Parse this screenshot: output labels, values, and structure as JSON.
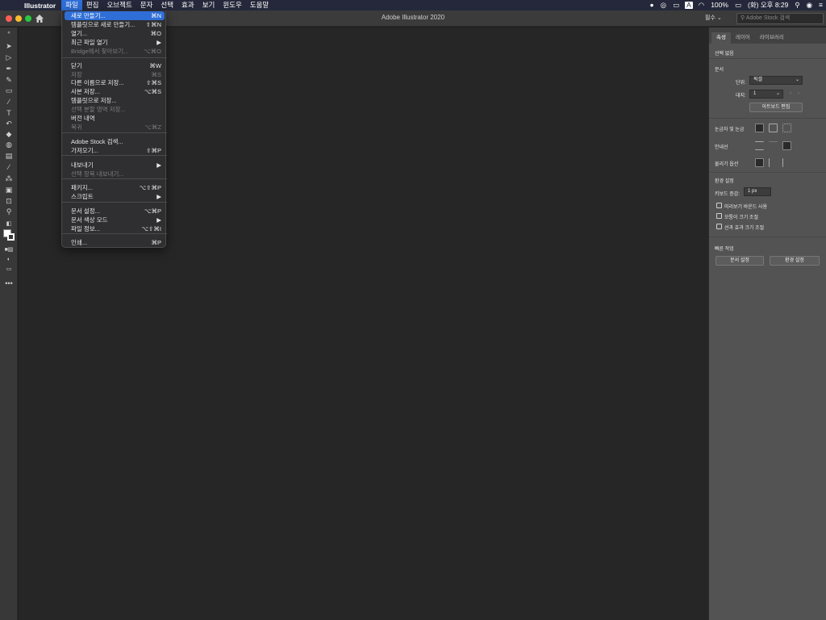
{
  "menubar": {
    "app_name": "Illustrator",
    "menus": [
      "파일",
      "편집",
      "오브젝트",
      "문자",
      "선택",
      "효과",
      "보기",
      "윈도우",
      "도움말"
    ],
    "battery": "100%",
    "clock": "(화) 오후 8:29",
    "input_source": "A"
  },
  "titlebar": {
    "title": "Adobe Illustrator 2020",
    "workspace": "필수",
    "stock_placeholder": "Adobe Stock 검색"
  },
  "file_menu": {
    "items": [
      {
        "label": "새로 만들기...",
        "shortcut": "⌘N",
        "state": "highlight"
      },
      {
        "label": "템플릿으로 새로 만들기...",
        "shortcut": "⇧⌘N",
        "state": "normal"
      },
      {
        "label": "열기...",
        "shortcut": "⌘O",
        "state": "normal"
      },
      {
        "label": "최근 파일 열기",
        "shortcut": "▶",
        "state": "normal"
      },
      {
        "label": "Bridge에서 찾아보기...",
        "shortcut": "⌥⌘O",
        "state": "disabled"
      },
      {
        "label": "닫기",
        "shortcut": "⌘W",
        "state": "normal"
      },
      {
        "label": "저장",
        "shortcut": "⌘S",
        "state": "disabled"
      },
      {
        "label": "다른 이름으로 저장...",
        "shortcut": "⇧⌘S",
        "state": "normal"
      },
      {
        "label": "사본 저장...",
        "shortcut": "⌥⌘S",
        "state": "normal"
      },
      {
        "label": "템플릿으로 저장...",
        "shortcut": "",
        "state": "normal"
      },
      {
        "label": "선택 분할 영역 저장...",
        "shortcut": "",
        "state": "disabled"
      },
      {
        "label": "버전 내역",
        "shortcut": "",
        "state": "normal"
      },
      {
        "label": "복귀",
        "shortcut": "⌥⌘Z",
        "state": "disabled"
      },
      {
        "label": "Adobe Stock 검색...",
        "shortcut": "",
        "state": "normal"
      },
      {
        "label": "가져오기...",
        "shortcut": "⇧⌘P",
        "state": "normal"
      },
      {
        "label": "내보내기",
        "shortcut": "▶",
        "state": "normal"
      },
      {
        "label": "선택 항목 내보내기...",
        "shortcut": "",
        "state": "disabled"
      },
      {
        "label": "패키지...",
        "shortcut": "⌥⇧⌘P",
        "state": "normal"
      },
      {
        "label": "스크립트",
        "shortcut": "▶",
        "state": "normal"
      },
      {
        "label": "문서 설정...",
        "shortcut": "⌥⌘P",
        "state": "normal"
      },
      {
        "label": "문서 색상 모드",
        "shortcut": "▶",
        "state": "normal"
      },
      {
        "label": "파일 정보...",
        "shortcut": "⌥⇧⌘I",
        "state": "normal"
      },
      {
        "label": "인쇄...",
        "shortcut": "⌘P",
        "state": "normal"
      }
    ]
  },
  "panel": {
    "tabs": [
      "속성",
      "레이어",
      "라이브러리"
    ],
    "no_selection": "선택 없음",
    "document_heading": "문서",
    "units_label": "단위:",
    "units_value": "픽셀",
    "artboard_label": "대지:",
    "artboard_value": "1",
    "edit_artboards_button": "아트보드 편집",
    "rulers_grids_label": "눈금자 및 눈금",
    "guides_label": "안내선",
    "snap_label": "물리기 옵션",
    "preferences_heading": "환경 설정",
    "keyboard_increment_label": "키보드 증감:",
    "keyboard_increment_value": "1 px",
    "checkboxes": [
      "미리보기 바운드 사용",
      "모퉁이 크기 조절",
      "선과 효과 크기 조절"
    ],
    "quick_actions_heading": "빠른 작업",
    "document_setup_button": "문서 설정",
    "preferences_button": "환경 설정"
  },
  "colors": {
    "highlight": "#2f6ed6",
    "canvas": "#262626",
    "panel": "#535353",
    "close": "#ff5f57",
    "minimize": "#febc2e",
    "zoom": "#28c840"
  }
}
